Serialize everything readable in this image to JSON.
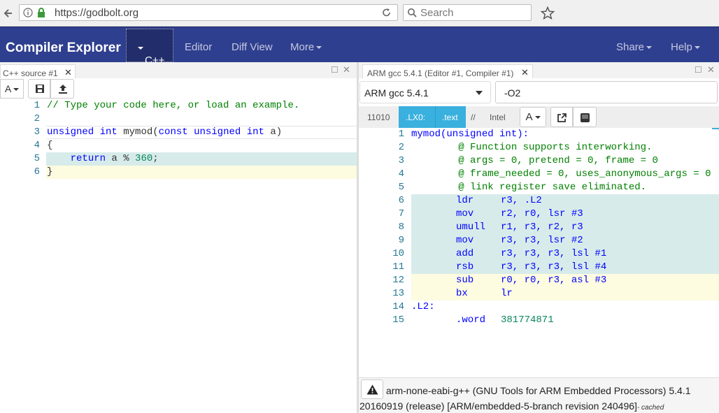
{
  "browser": {
    "url": "https://godbolt.org",
    "search_placeholder": "Search"
  },
  "navbar": {
    "brand": "Compiler Explorer",
    "language": "C++",
    "items": [
      "Editor",
      "Diff View",
      "More"
    ],
    "right_items": [
      "Share",
      "Help"
    ]
  },
  "source_pane": {
    "tab_title": "C++ source #1",
    "font_button": "A",
    "lines": [
      {
        "n": "1",
        "text": "// Type your code here, or load an example."
      },
      {
        "n": "2",
        "text": ""
      },
      {
        "n": "3",
        "text": "unsigned int mymod(const unsigned int a)"
      },
      {
        "n": "4",
        "text": "{"
      },
      {
        "n": "5",
        "text": "    return a % 360;"
      },
      {
        "n": "6",
        "text": "}"
      }
    ]
  },
  "compiler_pane": {
    "tab_title": "ARM gcc 5.4.1 (Editor #1, Compiler #1)",
    "compiler": "ARM gcc 5.4.1",
    "options": "-O2",
    "filters": [
      "11010",
      ".LX0:",
      ".text",
      "//",
      "Intel"
    ],
    "font_button": "A",
    "asm": [
      {
        "n": "1",
        "text": "mymod(unsigned int):"
      },
      {
        "n": "2",
        "text": "        @ Function supports interworking."
      },
      {
        "n": "3",
        "text": "        @ args = 0, pretend = 0, frame = 0"
      },
      {
        "n": "4",
        "text": "        @ frame_needed = 0, uses_anonymous_args = 0"
      },
      {
        "n": "5",
        "text": "        @ link register save eliminated."
      },
      {
        "n": "6",
        "op": "ldr",
        "args": "r3, .L2"
      },
      {
        "n": "7",
        "op": "mov",
        "args": "r2, r0, lsr #3"
      },
      {
        "n": "8",
        "op": "umull",
        "args": "r1, r3, r2, r3"
      },
      {
        "n": "9",
        "op": "mov",
        "args": "r3, r3, lsr #2"
      },
      {
        "n": "10",
        "op": "add",
        "args": "r3, r3, r3, lsl #1"
      },
      {
        "n": "11",
        "op": "rsb",
        "args": "r3, r3, r3, lsl #4"
      },
      {
        "n": "12",
        "op": "sub",
        "args": "r0, r0, r3, asl #3"
      },
      {
        "n": "13",
        "op": "bx",
        "args": "lr"
      },
      {
        "n": "14",
        "text": ".L2:"
      },
      {
        "n": "15",
        "op": ".word",
        "args": "381774871"
      }
    ],
    "status_line1": "arm-none-eabi-g++ (GNU Tools for ARM Embedded Processors) 5.4.1",
    "status_line2": "20160919 (release) [ARM/embedded-5-branch revision 240496]",
    "status_cached": "- cached"
  },
  "colors": {
    "navbar": "#2f3f8f",
    "highlight_teal": "#d7ecea",
    "highlight_yellow": "#fdfbe0",
    "filter_active": "#39b0dd"
  }
}
